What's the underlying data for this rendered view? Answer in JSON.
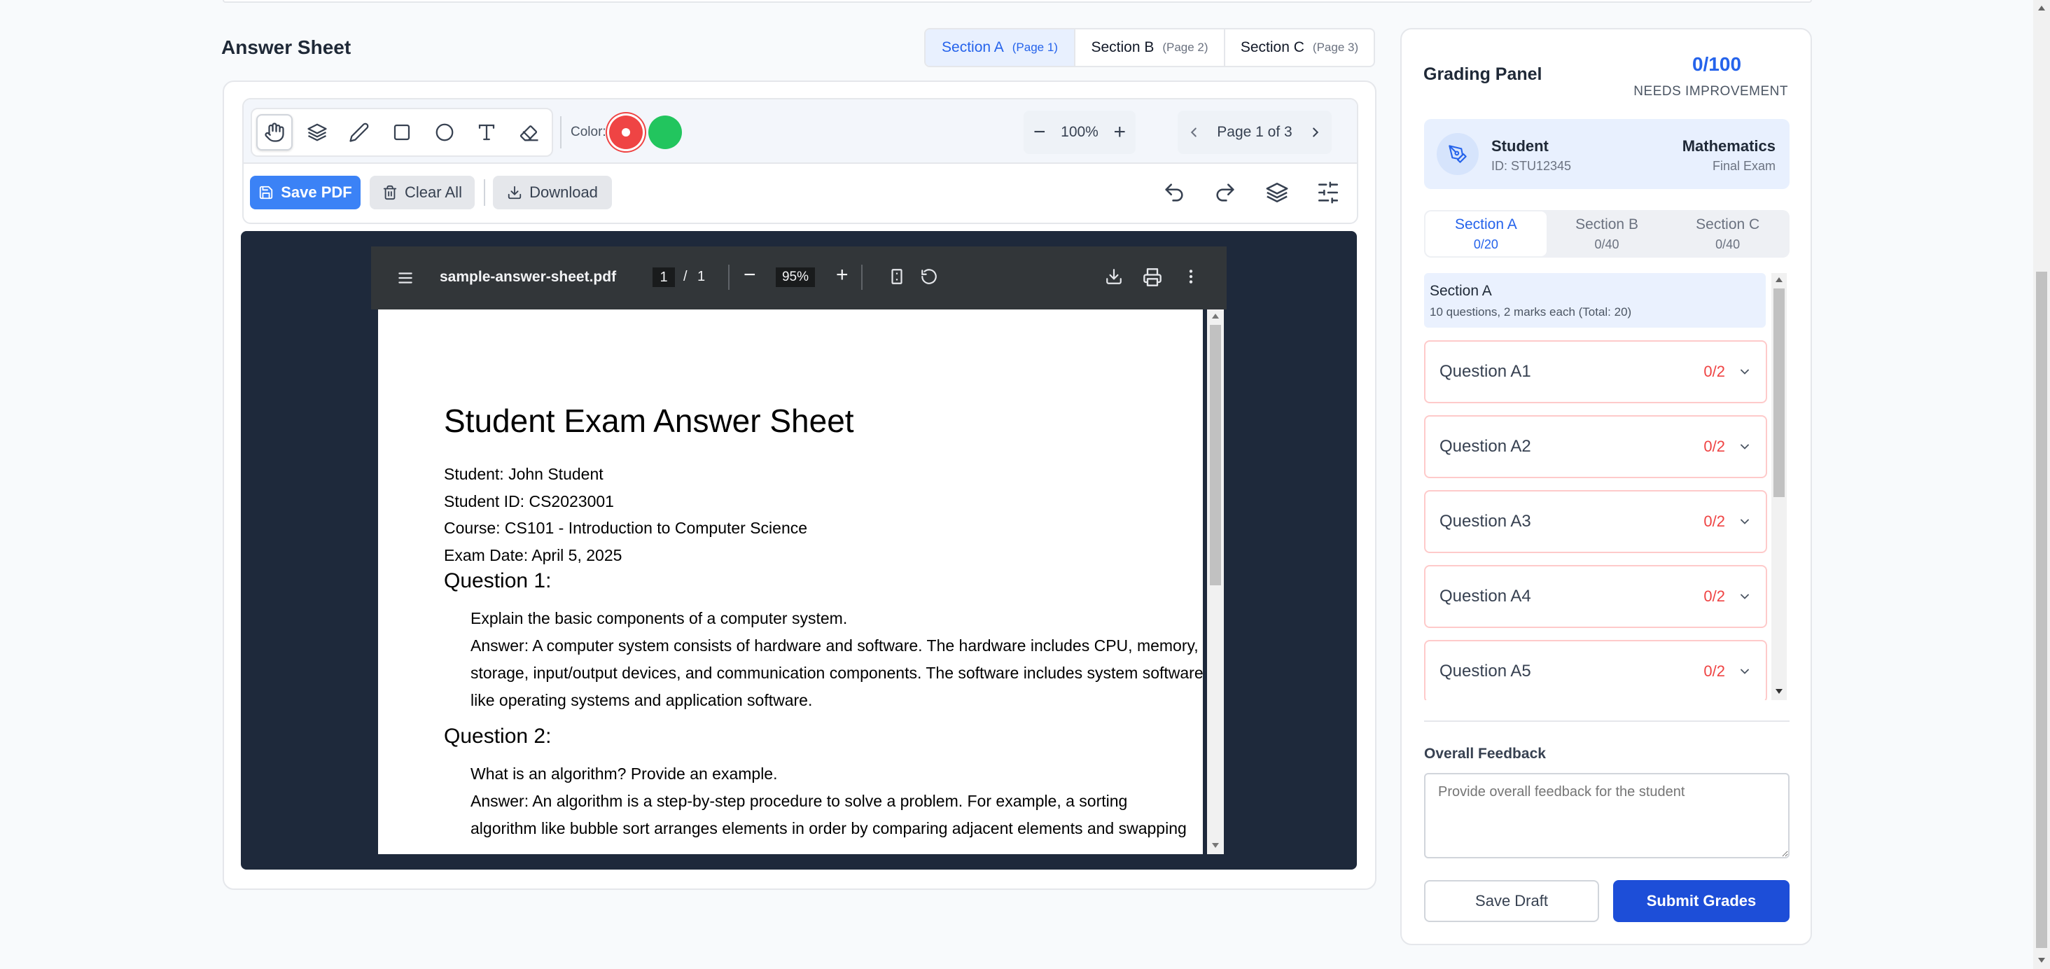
{
  "answer_sheet": {
    "title": "Answer Sheet",
    "section_tabs": [
      {
        "label": "Section A",
        "page": "(Page 1)"
      },
      {
        "label": "Section B",
        "page": "(Page 2)"
      },
      {
        "label": "Section C",
        "page": "(Page 3)"
      }
    ],
    "active_section": "Section A"
  },
  "toolbar": {
    "tools": [
      "hand-icon",
      "layers-icon",
      "pen-icon",
      "rectangle-icon",
      "circle-icon",
      "text-icon",
      "eraser-icon"
    ],
    "active_tool": "hand-icon",
    "color_label": "Color:",
    "colors": [
      "#ef4444",
      "#22c55e"
    ],
    "selected_color": "#ef4444",
    "zoom": "100%",
    "page_label": "Page 1 of 3",
    "save_pdf_label": "Save PDF",
    "clear_all_label": "Clear All",
    "download_label": "Download"
  },
  "pdf_viewer": {
    "filename": "sample-answer-sheet.pdf",
    "page_current": "1",
    "page_sep": "/",
    "page_total": "1",
    "zoom": "95%"
  },
  "document": {
    "heading": "Student Exam Answer Sheet",
    "meta": [
      "Student: John Student",
      "Student ID: CS2023001",
      "Course: CS101 - Introduction to Computer Science",
      "Exam Date: April 5, 2025"
    ],
    "q1_title": "Question 1:",
    "q1_lines": [
      "Explain the basic components of a computer system.",
      "Answer: A computer system consists of hardware and software. The hardware includes CPU, memory,",
      "storage, input/output devices, and communication components. The software includes system software",
      "like operating systems and application software."
    ],
    "q2_title": "Question 2:",
    "q2_lines": [
      "What is an algorithm? Provide an example.",
      "Answer: An algorithm is a step-by-step procedure to solve a problem. For example, a sorting",
      "algorithm like bubble sort arranges elements in order by comparing adjacent elements and swapping"
    ]
  },
  "grading_panel": {
    "title": "Grading Panel",
    "total_score": "0/100",
    "status": "NEEDS IMPROVEMENT",
    "student_label": "Student",
    "student_id": "ID: STU12345",
    "subject": "Mathematics",
    "exam_type": "Final Exam",
    "section_tabs": [
      {
        "label": "Section A",
        "score": "0/20"
      },
      {
        "label": "Section B",
        "score": "0/40"
      },
      {
        "label": "Section C",
        "score": "0/40"
      }
    ],
    "section_info_title": "Section A",
    "section_info_desc": "10 questions, 2 marks each (Total: 20)",
    "questions": [
      {
        "label": "Question A1",
        "score": "0/2"
      },
      {
        "label": "Question A2",
        "score": "0/2"
      },
      {
        "label": "Question A3",
        "score": "0/2"
      },
      {
        "label": "Question A4",
        "score": "0/2"
      },
      {
        "label": "Question A5",
        "score": "0/2"
      }
    ],
    "feedback_label": "Overall Feedback",
    "feedback_placeholder": "Provide overall feedback for the student",
    "save_draft_label": "Save Draft",
    "submit_label": "Submit Grades"
  },
  "colors": {
    "accent": "#2563eb",
    "danger": "#ef4444",
    "success": "#22c55e",
    "pdf_background": "#1e293b"
  }
}
